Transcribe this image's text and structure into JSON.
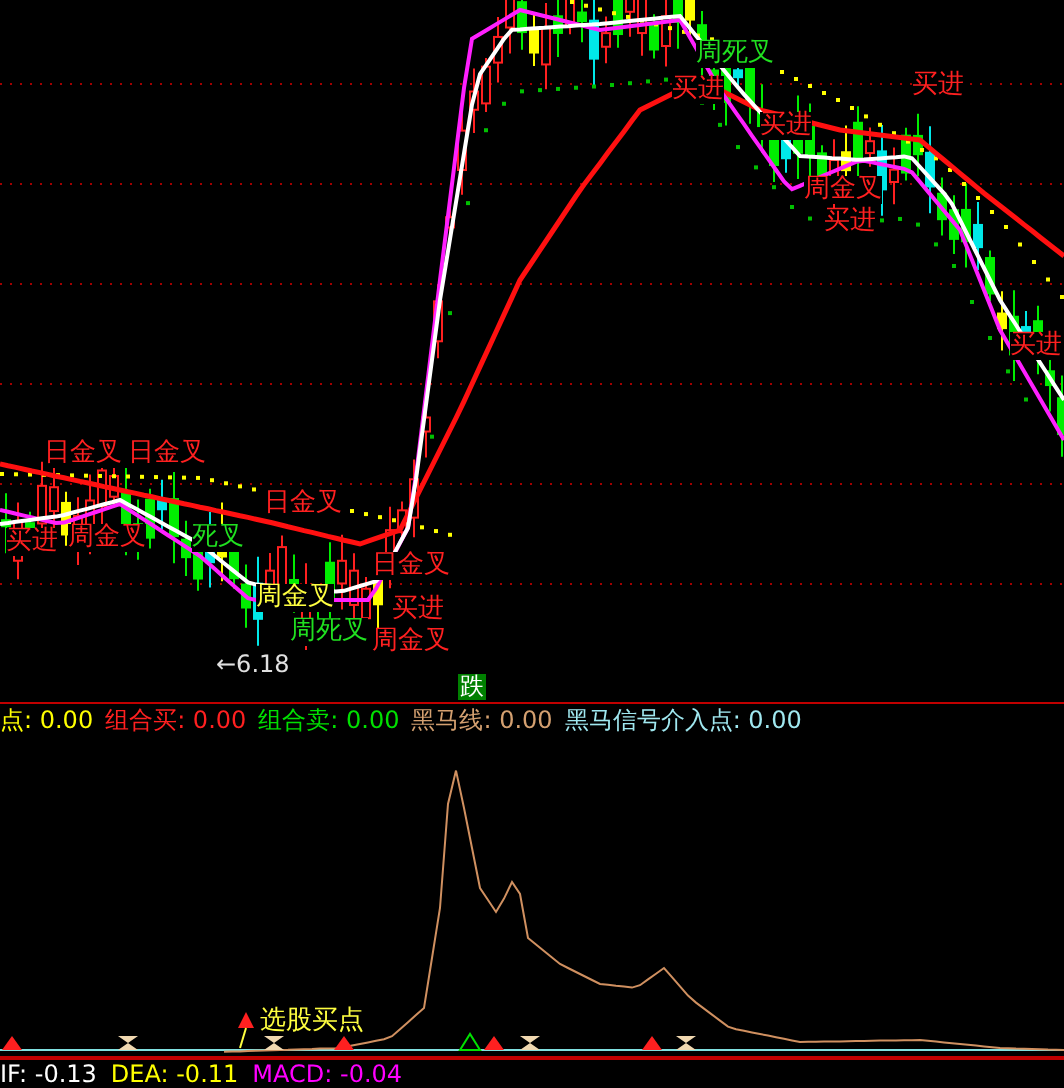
{
  "main_chart": {
    "badge": "跌",
    "price_label": "←6.18",
    "annotations": [
      {
        "text": "周死叉",
        "color": "#20e020"
      },
      {
        "text": "买进",
        "color": "#ff2020"
      },
      {
        "text": "买进",
        "color": "#ff2020"
      },
      {
        "text": "买进",
        "color": "#ff2020"
      },
      {
        "text": "周金叉",
        "color": "#ff2020"
      },
      {
        "text": "买进",
        "color": "#ff2020"
      },
      {
        "text": "买进",
        "color": "#ff2020"
      },
      {
        "text": "日金叉",
        "color": "#ff2020"
      },
      {
        "text": "日金叉",
        "color": "#ff2020"
      },
      {
        "text": "日金叉",
        "color": "#ff2020"
      },
      {
        "text": "买进",
        "color": "#ff2020"
      },
      {
        "text": "周金叉",
        "color": "#ff2020"
      },
      {
        "text": "死叉",
        "color": "#20e020"
      },
      {
        "text": "日金叉",
        "color": "#ff2020"
      },
      {
        "text": "周金叉",
        "color": "#ffff40"
      },
      {
        "text": "买进",
        "color": "#ff2020"
      },
      {
        "text": "周死叉",
        "color": "#20e020"
      },
      {
        "text": "周金叉",
        "color": "#ff2020"
      }
    ]
  },
  "legend": [
    {
      "text": "点: 0.00",
      "color": "#ffff00"
    },
    {
      "text": "组合买: 0.00",
      "color": "#ff2020"
    },
    {
      "text": "组合卖: 0.00",
      "color": "#00e000"
    },
    {
      "text": "黑马线: 0.00",
      "color": "#d4a070"
    },
    {
      "text": "黑马信号介入点: 0.00",
      "color": "#a0e8f0"
    }
  ],
  "indicator_chart": {
    "annotation": "选股买点"
  },
  "macd_legend": [
    {
      "text": "IF: -0.13",
      "color": "#ffffff"
    },
    {
      "text": "DEA: -0.11",
      "color": "#ffff00"
    },
    {
      "text": "MACD: -0.04",
      "color": "#ff00ff"
    }
  ]
}
